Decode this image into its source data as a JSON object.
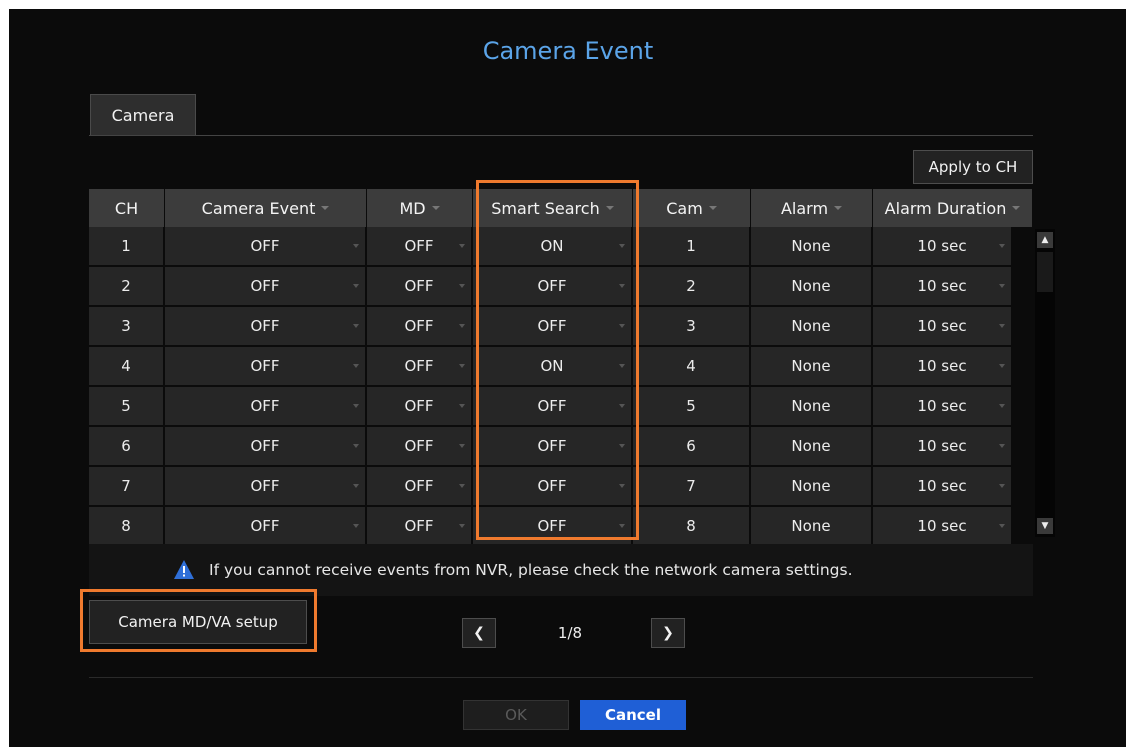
{
  "dialog": {
    "title": "Camera Event"
  },
  "tabs": [
    {
      "label": "Camera"
    }
  ],
  "apply_button": "Apply to CH",
  "table": {
    "headers": [
      "CH",
      "Camera Event",
      "MD",
      "Smart Search",
      "Cam",
      "Alarm",
      "Alarm Duration"
    ],
    "rows": [
      {
        "ch": "1",
        "camera_event": "OFF",
        "md": "OFF",
        "smart_search": "ON",
        "cam": "1",
        "alarm": "None",
        "alarm_duration": "10 sec"
      },
      {
        "ch": "2",
        "camera_event": "OFF",
        "md": "OFF",
        "smart_search": "OFF",
        "cam": "2",
        "alarm": "None",
        "alarm_duration": "10 sec"
      },
      {
        "ch": "3",
        "camera_event": "OFF",
        "md": "OFF",
        "smart_search": "OFF",
        "cam": "3",
        "alarm": "None",
        "alarm_duration": "10 sec"
      },
      {
        "ch": "4",
        "camera_event": "OFF",
        "md": "OFF",
        "smart_search": "ON",
        "cam": "4",
        "alarm": "None",
        "alarm_duration": "10 sec"
      },
      {
        "ch": "5",
        "camera_event": "OFF",
        "md": "OFF",
        "smart_search": "OFF",
        "cam": "5",
        "alarm": "None",
        "alarm_duration": "10 sec"
      },
      {
        "ch": "6",
        "camera_event": "OFF",
        "md": "OFF",
        "smart_search": "OFF",
        "cam": "6",
        "alarm": "None",
        "alarm_duration": "10 sec"
      },
      {
        "ch": "7",
        "camera_event": "OFF",
        "md": "OFF",
        "smart_search": "OFF",
        "cam": "7",
        "alarm": "None",
        "alarm_duration": "10 sec"
      },
      {
        "ch": "8",
        "camera_event": "OFF",
        "md": "OFF",
        "smart_search": "OFF",
        "cam": "8",
        "alarm": "None",
        "alarm_duration": "10 sec"
      }
    ]
  },
  "notice": {
    "icon": "warning-icon",
    "text": "If you cannot receive events from NVR, please check the network camera settings."
  },
  "setup_button": "Camera MD/VA setup",
  "pager": {
    "prev_icon": "chevron-left-icon",
    "label": "1/8",
    "next_icon": "chevron-right-icon"
  },
  "footer": {
    "ok": "OK",
    "cancel": "Cancel"
  },
  "colors": {
    "accent": "#5ba4e8",
    "highlight": "#ef7a2e",
    "cancel_bg": "#1f5fd6",
    "panel_bg": "#0b0b0b"
  }
}
